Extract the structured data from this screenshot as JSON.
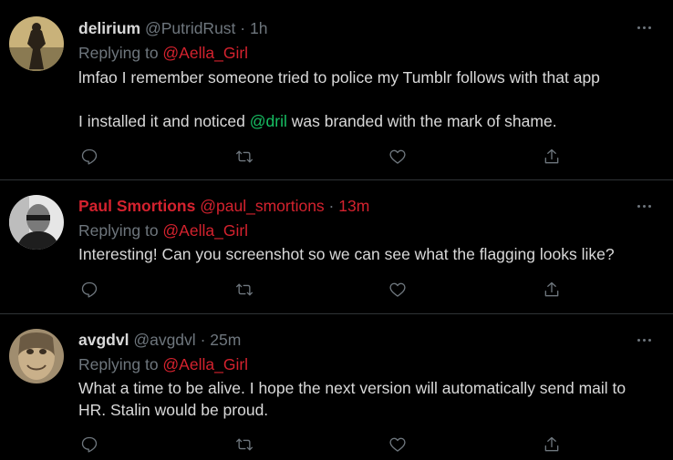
{
  "tweets": [
    {
      "name": "delirium",
      "handle": "@PutridRust",
      "sep": "·",
      "time": "1h",
      "replying_prefix": "Replying to ",
      "replying_to": "@Aella_Girl",
      "line1": "lmfao I remember someone tried to police my Tumblr follows with that app",
      "line2_pre": "I installed it and noticed ",
      "line2_mention": "@dril",
      "line2_post": " was branded with the mark of shame."
    },
    {
      "name": "Paul Smortions",
      "handle": "@paul_smortions",
      "sep": "·",
      "time": "13m",
      "replying_prefix": "Replying to ",
      "replying_to": "@Aella_Girl",
      "line1": "Interesting! Can you screenshot so we can see what the flagging looks like?"
    },
    {
      "name": "avgdvl",
      "handle": "@avgdvl",
      "sep": "·",
      "time": "25m",
      "replying_prefix": "Replying to ",
      "replying_to": "@Aella_Girl",
      "line1": "What a time to be alive. I hope the next version will automatically send mail to HR. Stalin would be proud."
    }
  ],
  "icons": {
    "more": "more-icon",
    "reply": "reply-icon",
    "retweet": "retweet-icon",
    "like": "like-icon",
    "share": "share-icon"
  },
  "colors": {
    "background": "#000000",
    "text": "#d9d9d9",
    "muted": "#6e767d",
    "mention_red": "#d4222e",
    "mention_green": "#17bf63",
    "divider": "#2f3336"
  }
}
